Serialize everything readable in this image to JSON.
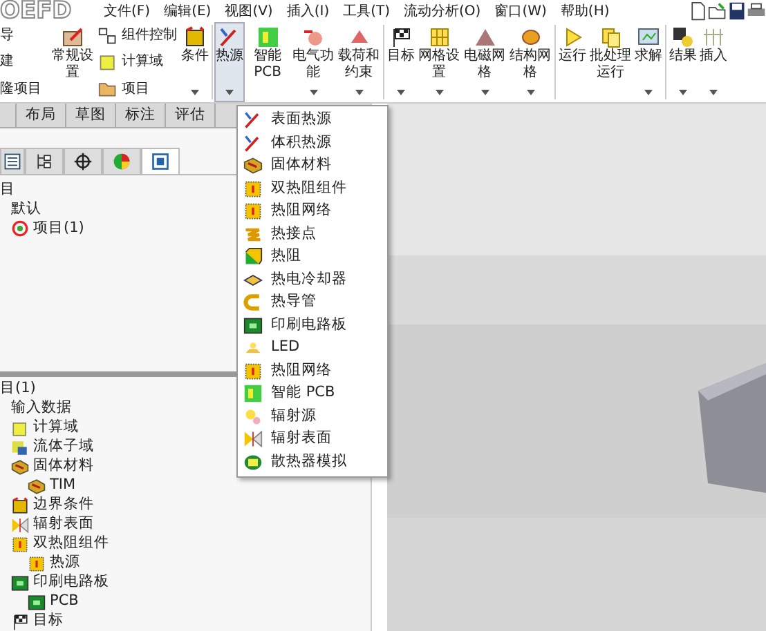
{
  "app_logo": "OEFD",
  "menu_bar": [
    "文件(F)",
    "编辑(E)",
    "视图(V)",
    "插入(I)",
    "工具(T)",
    "流动分析(O)",
    "窗口(W)",
    "帮助(H)"
  ],
  "toolbar": {
    "cut_labels": [
      "导",
      "建",
      "隆项目"
    ],
    "items": [
      {
        "kind": "large",
        "label": "常规设置",
        "caret": false,
        "selected": false
      },
      {
        "kind": "stack",
        "entries": [
          "组件控制",
          "计算域",
          "项目"
        ]
      },
      {
        "kind": "large",
        "label": "条件",
        "caret": true,
        "selected": false
      },
      {
        "kind": "large",
        "label": "热源",
        "caret": true,
        "selected": true
      },
      {
        "kind": "large",
        "label": "智能PCB",
        "caret": false,
        "selected": false
      },
      {
        "kind": "large",
        "label": "电气功能",
        "caret": true,
        "selected": false
      },
      {
        "kind": "large",
        "label": "载荷和约束",
        "caret": true,
        "selected": false
      },
      {
        "kind": "large",
        "label": "目标",
        "caret": true,
        "selected": false
      },
      {
        "kind": "large",
        "label": "网格设置",
        "caret": true,
        "selected": false
      },
      {
        "kind": "large",
        "label": "电磁网格",
        "caret": true,
        "selected": false
      },
      {
        "kind": "large",
        "label": "结构网格",
        "caret": true,
        "selected": false
      },
      {
        "kind": "large",
        "label": "运行",
        "caret": false,
        "selected": false
      },
      {
        "kind": "large",
        "label": "批处理运行",
        "caret": false,
        "selected": false
      },
      {
        "kind": "large",
        "label": "求解",
        "caret": true,
        "selected": false
      },
      {
        "kind": "large",
        "label": "结果",
        "caret": true,
        "selected": false
      },
      {
        "kind": "large",
        "label": "插入",
        "caret": true,
        "selected": false
      }
    ]
  },
  "tabs": [
    {
      "selected": false
    },
    {
      "label": "布局",
      "selected": false
    },
    {
      "label": "草图",
      "selected": false
    },
    {
      "label": "标注",
      "selected": false
    },
    {
      "label": "评估",
      "selected": false
    }
  ],
  "panel_tabs": [
    {
      "selected": false
    },
    {
      "selected": false
    },
    {
      "selected": false
    },
    {
      "selected": false
    },
    {
      "selected": true
    }
  ],
  "top_tree": [
    {
      "label": "目",
      "children": [
        {
          "label": "默认"
        },
        {
          "label": "项目(1)"
        }
      ]
    }
  ],
  "lower_tree": [
    {
      "label": "目(1)",
      "children": [
        {
          "label": "输入数据"
        },
        {
          "label": "计算域"
        },
        {
          "label": "流体子域"
        },
        {
          "label": "固体材料",
          "children": [
            {
              "label": "TIM"
            }
          ]
        },
        {
          "label": "边界条件"
        },
        {
          "label": "辐射表面"
        },
        {
          "label": "双热阻组件",
          "children": [
            {
              "label": "热源"
            }
          ]
        },
        {
          "label": "印刷电路板",
          "children": [
            {
              "label": "PCB"
            }
          ]
        },
        {
          "label": "目标"
        }
      ]
    }
  ],
  "dropdown": [
    "表面热源",
    "体积热源",
    "固体材料",
    "双热阻组件",
    "热阻网络",
    "热接点",
    "热阻",
    "热电冷却器",
    "热导管",
    "印刷电路板",
    "LED",
    "热阻网络",
    "智能 PCB",
    "辐射源",
    "辐射表面",
    "散热器模拟"
  ]
}
